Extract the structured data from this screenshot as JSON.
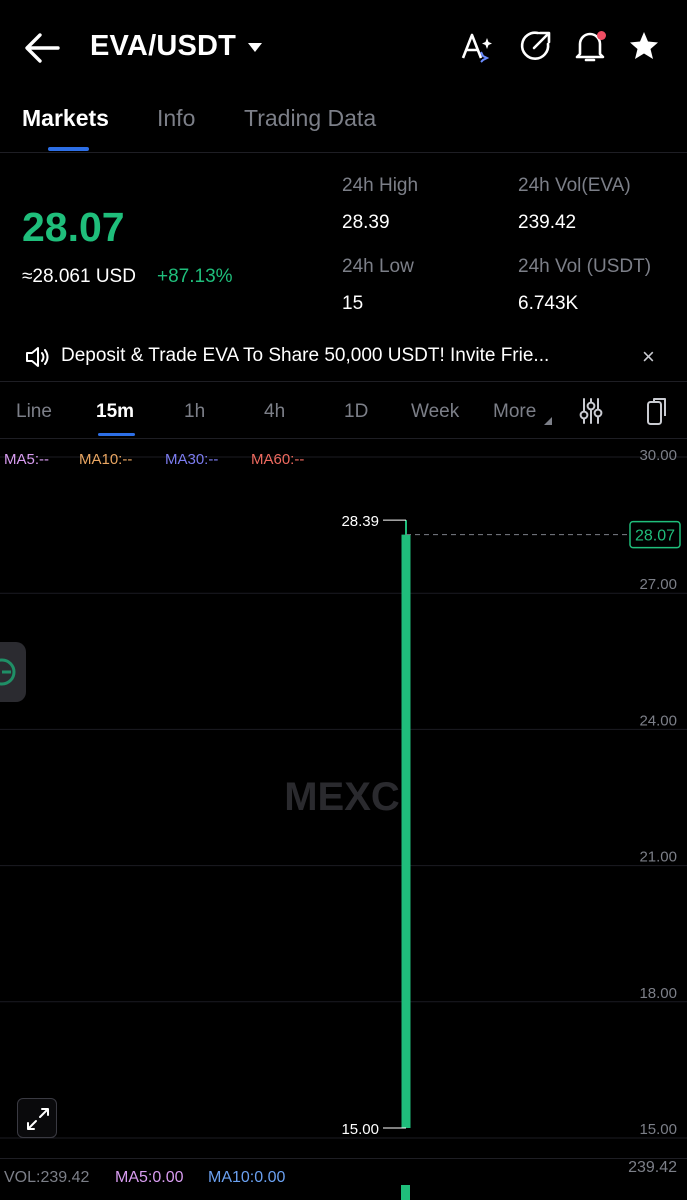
{
  "header": {
    "pair": "EVA/USDT",
    "icons": [
      "back-arrow-icon",
      "caret-down-icon",
      "text-ai-icon",
      "share-icon",
      "bell-icon",
      "star-icon"
    ]
  },
  "tabs": [
    {
      "label": "Markets",
      "active": true
    },
    {
      "label": "Info",
      "active": false
    },
    {
      "label": "Trading Data",
      "active": false
    }
  ],
  "ticker": {
    "last_price": "28.07",
    "usd_value": "≈28.061 USD",
    "change": "+87.13%",
    "high_label": "24h High",
    "high_value": "28.39",
    "low_label": "24h Low",
    "low_value": "15",
    "vol_eva_label": "24h Vol(EVA)",
    "vol_eva_value": "239.42",
    "vol_usdt_label": "24h Vol (USDT)",
    "vol_usdt_value": "6.743K"
  },
  "banner": {
    "text": "Deposit & Trade EVA To Share  50,000 USDT! Invite Frie...",
    "close": "×"
  },
  "chart_tabs": [
    {
      "label": "Line",
      "active": false
    },
    {
      "label": "15m",
      "active": true
    },
    {
      "label": "1h",
      "active": false
    },
    {
      "label": "4h",
      "active": false
    },
    {
      "label": "1D",
      "active": false
    },
    {
      "label": "Week",
      "active": false
    },
    {
      "label": "More",
      "active": false
    }
  ],
  "indicators": {
    "ma5": "MA5:--",
    "ma10": "MA10:--",
    "ma30": "MA30:--",
    "ma60": "MA60:--"
  },
  "chart_data": {
    "type": "candlestick",
    "y_axis_ticks": [
      "30.00",
      "27.00",
      "24.00",
      "21.00",
      "18.00",
      "15.00"
    ],
    "ylim": [
      15.0,
      30.0
    ],
    "candles": [
      {
        "open": 15.0,
        "high": 28.39,
        "low": 15.0,
        "close": 28.07
      }
    ],
    "high_label": "28.39",
    "low_label": "15.00",
    "current_price_label": "28.07",
    "watermark": "MEXC",
    "colors": {
      "up": "#1fbe7b",
      "down": "#ef4d63",
      "accent": "#2d6fe6"
    }
  },
  "volume": {
    "vol": "VOL:239.42",
    "ma5": "MA5:0.00",
    "ma10": "MA10:0.00",
    "axis_max": "239.42"
  }
}
